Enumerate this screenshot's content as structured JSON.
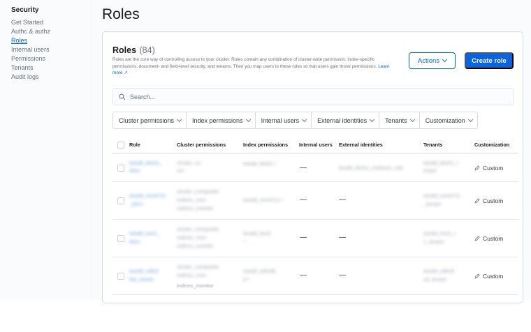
{
  "sidebar": {
    "title": "Security",
    "items": [
      {
        "label": "Get Started"
      },
      {
        "label": "Authc & authz"
      },
      {
        "label": "Roles"
      },
      {
        "label": "Internal users"
      },
      {
        "label": "Permissions"
      },
      {
        "label": "Tenants"
      },
      {
        "label": "Audit logs"
      }
    ]
  },
  "page": {
    "title": "Roles"
  },
  "panel": {
    "heading": "Roles",
    "count": "(84)",
    "description": "Roles are the core way of controlling access to your cluster. Roles contain any combination of cluster-wide permission, index-specific permissions, document- and field-level security, and tenants. Then you map users to these roles so that users gain those permissions.",
    "learn_more": "Learn more",
    "actions_label": "Actions",
    "create_label": "Create role"
  },
  "search": {
    "placeholder": "Search..."
  },
  "filters": [
    {
      "label": "Cluster permissions"
    },
    {
      "label": "Index permissions"
    },
    {
      "label": "Internal users"
    },
    {
      "label": "External identities"
    },
    {
      "label": "Tenants"
    },
    {
      "label": "Customization"
    }
  ],
  "table": {
    "headers": {
      "role": "Role",
      "cluster": "Cluster permissions",
      "index": "Index permissions",
      "internal": "Internal users",
      "external": "External identities",
      "tenants": "Tenants",
      "customization": "Customization"
    },
    "rows": [
      {
        "role": "twsdd_kks01_",
        "role2": "kikm",
        "cluster": "cluster_co",
        "cluster2": "nm",
        "index": "twsdd_kks01.*",
        "internal": "—",
        "external": "twsdd_kks01_instance_role",
        "tenants": "twsdd_kks01_t",
        "tenants2": "enant",
        "custom": "Custom"
      },
      {
        "role": "twsdd_mm0721",
        "role2": "_kikm",
        "cluster": "cluster_composite",
        "cluster2": "indices_mon",
        "cluster3": "indices_monitor",
        "index": "twsdd_mm0721.*",
        "internal": "—",
        "external": "—",
        "tenants": "twsdd_mm0721",
        "tenants2": "_tenant",
        "custom": "Custom"
      },
      {
        "role": "twsdd_test1_",
        "role2": "kikm",
        "cluster": "cluster_composite",
        "cluster2": "indices_mon",
        "cluster3": "indices_monitor",
        "index": "twsdd_test1.",
        "index2": "*",
        "internal": "—",
        "external": "—",
        "tenants": "twsdd_test1_t",
        "tenants2": "1_tenant",
        "custom": "Custom"
      },
      {
        "role": "twsdd_sdfsd",
        "role2": "fsd_viewer",
        "cluster": "cluster_composite",
        "cluster2": "indices_mon",
        "cluster3": "indices_monitor",
        "index": "twsdd_sdfsdfs",
        "index2": "d.*",
        "internal": "—",
        "external": "—",
        "tenants": "twsdd_sdfsdf",
        "tenants2": "sd_tenant",
        "custom": "Custom"
      }
    ]
  }
}
